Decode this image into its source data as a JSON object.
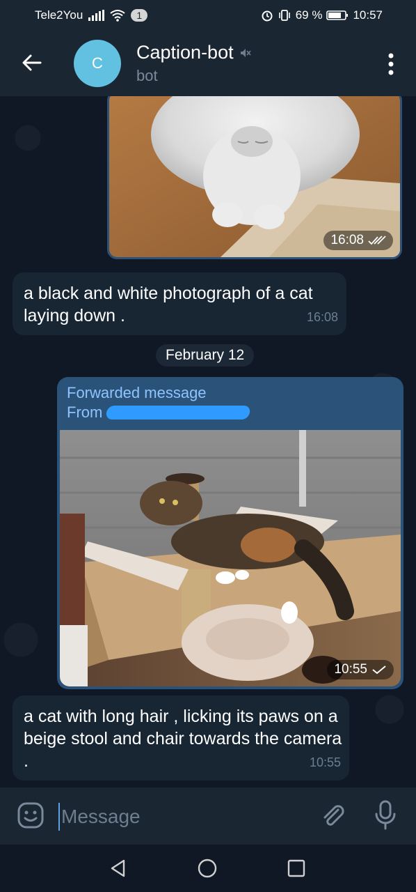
{
  "status_bar": {
    "carrier": "Tele2You",
    "notification_count": "1",
    "battery": "69 %",
    "time": "10:57"
  },
  "header": {
    "avatar_letter": "C",
    "title": "Caption-bot",
    "subtitle": "bot",
    "icons": [
      "back-arrow-icon",
      "muted-icon",
      "more-vert-icon"
    ]
  },
  "messages": [
    {
      "type": "photo",
      "direction": "out",
      "time": "16:08",
      "status": "read"
    },
    {
      "type": "text",
      "direction": "in",
      "text": "a black and white photograph of a cat laying down .",
      "time": "16:08"
    },
    {
      "type": "date",
      "text": "February 12"
    },
    {
      "type": "forwarded_photo",
      "direction": "out",
      "forward_label": "Forwarded message",
      "from_label": "From",
      "time": "10:55",
      "status": "sent"
    },
    {
      "type": "text",
      "direction": "in",
      "text": "a cat with long hair , licking its paws on a beige stool and chair towards the camera .",
      "time": "10:55"
    }
  ],
  "composer": {
    "placeholder": "Message"
  },
  "colors": {
    "background": "#0e1621",
    "header": "#1b2633",
    "bubble_in": "#182533",
    "bubble_out": "#2b5278",
    "accent": "#62c1e0",
    "link": "#8dc4ff"
  }
}
